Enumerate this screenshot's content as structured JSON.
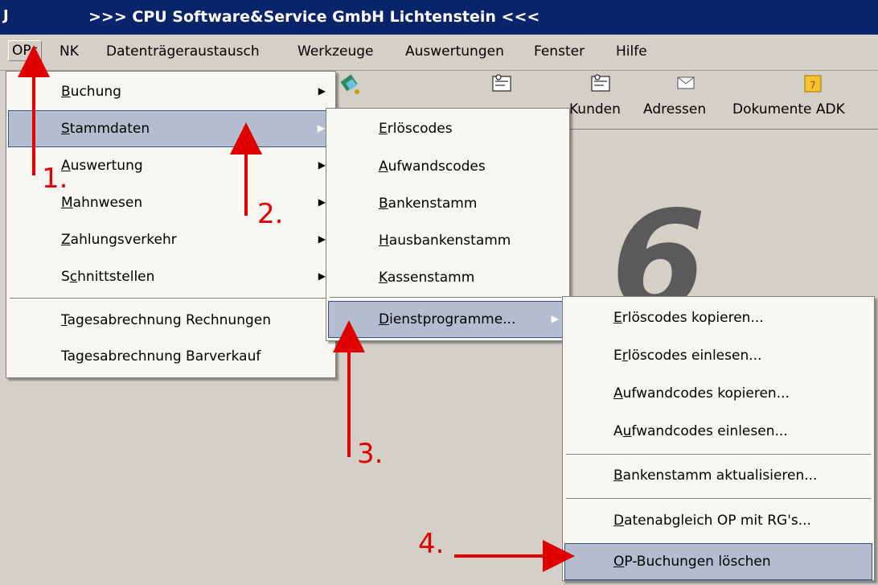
{
  "window": {
    "icon_char": "J",
    "title": ">>> CPU Software&Service GmbH Lichtenstein <<<"
  },
  "menubar": {
    "items": [
      {
        "label": "OPs"
      },
      {
        "label": "NK"
      },
      {
        "label": "Datenträgeraustausch"
      },
      {
        "label": "Werkzeuge"
      },
      {
        "label": "Auswertungen"
      },
      {
        "label": "Fenster"
      },
      {
        "label": "Hilfe"
      }
    ]
  },
  "toolbar": {
    "buttons": [
      {
        "label": "",
        "icon": "puzzle-icon"
      },
      {
        "label": "",
        "icon": "card-file-icon"
      },
      {
        "label": "Kunden",
        "icon": "card-file-icon"
      },
      {
        "label": "Adressen",
        "icon": "envelope-icon"
      },
      {
        "label": "Dokumente ADK",
        "icon": "notepad-icon"
      }
    ]
  },
  "background": {
    "big_number": "6"
  },
  "menu_ops": {
    "items": [
      {
        "label": "Buchung",
        "accel": "B",
        "rest": "uchung"
      },
      {
        "label": "Stammdaten",
        "accel": "S",
        "rest": "tammdaten"
      },
      {
        "label": "Auswertung",
        "accel": "A",
        "rest": "uswertung"
      },
      {
        "label": "Mahnwesen",
        "accel": "M",
        "rest": "ahnwesen"
      },
      {
        "label": "Zahlungsverkehr",
        "accel": "Z",
        "rest": "ahlungsverkehr"
      },
      {
        "label": "Schnittstellen",
        "pre": "S",
        "accel": "c",
        "rest": "hnittstellen"
      },
      {
        "label": "Tagesabrechnung Rechnungen",
        "accel": "T",
        "rest": "agesabrechnung Rechnungen"
      },
      {
        "label": "Tagesabrechnung Barverkauf",
        "pre": "Ta",
        "accel": "g",
        "rest": "esabrechnung Barverkauf"
      }
    ]
  },
  "menu_stammdaten": {
    "items": [
      {
        "label": "Erlöscodes",
        "accel": "E",
        "rest": "rlöscodes"
      },
      {
        "label": "Aufwandscodes",
        "accel": "A",
        "rest": "ufwandscodes"
      },
      {
        "label": "Bankenstamm",
        "accel": "B",
        "rest": "ankenstamm"
      },
      {
        "label": "Hausbankenstamm",
        "accel": "H",
        "rest": "ausbankenstamm"
      },
      {
        "label": "Kassenstamm",
        "accel": "K",
        "rest": "assenstamm"
      },
      {
        "label": "Dienstprogramme...",
        "accel": "D",
        "rest": "ienstprogramme..."
      }
    ]
  },
  "menu_dienst": {
    "items": [
      {
        "label": "Erlöscodes kopieren...",
        "accel": "E",
        "rest": "rlöscodes kopieren..."
      },
      {
        "label": "Erlöscodes einlesen...",
        "pre": "E",
        "accel": "r",
        "rest": "löscodes einlesen..."
      },
      {
        "label": "Aufwandcodes kopieren...",
        "accel": "A",
        "rest": "ufwandcodes kopieren..."
      },
      {
        "label": "Aufwandcodes einlesen...",
        "pre": "A",
        "accel": "u",
        "rest": "fwandcodes einlesen..."
      },
      {
        "label": "Bankenstamm aktualisieren...",
        "accel": "B",
        "rest": "ankenstamm aktualisieren..."
      },
      {
        "label": "Datenabgleich OP mit RG's...",
        "accel": "D",
        "rest": "atenabgleich OP mit RG's..."
      },
      {
        "label": "OP-Buchungen löschen",
        "accel": "O",
        "rest": "P-Buchungen löschen"
      }
    ]
  },
  "annotations": {
    "step1": "1.",
    "step2": "2.",
    "step3": "3.",
    "step4": "4."
  },
  "colors": {
    "titlebar": "#0a246a",
    "menu_bg": "#f7f6f1",
    "selection": "#b4bdd0",
    "annotation": "#e00000"
  }
}
